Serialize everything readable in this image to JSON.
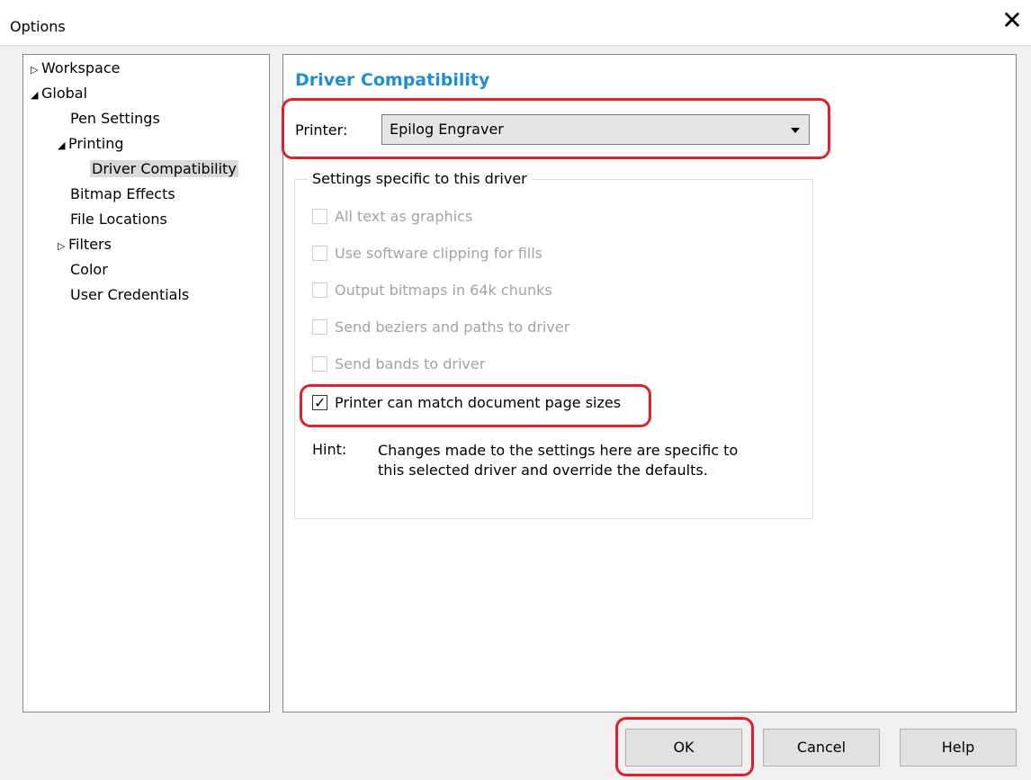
{
  "window": {
    "title": "Options",
    "close_glyph": "✕"
  },
  "tree": {
    "items": [
      {
        "label": "Workspace",
        "arrow": "▷"
      },
      {
        "label": "Global",
        "arrow": "◢"
      },
      {
        "label": "Pen Settings",
        "arrow": ""
      },
      {
        "label": "Printing",
        "arrow": "◢"
      },
      {
        "label": "Driver Compatibility",
        "arrow": "",
        "selected": true
      },
      {
        "label": "Bitmap Effects",
        "arrow": ""
      },
      {
        "label": "File Locations",
        "arrow": ""
      },
      {
        "label": "Filters",
        "arrow": "▷"
      },
      {
        "label": "Color",
        "arrow": ""
      },
      {
        "label": "User Credentials",
        "arrow": ""
      }
    ]
  },
  "panel": {
    "title": "Driver Compatibility",
    "printer_label": "Printer:",
    "printer_value": "Epilog Engraver",
    "group_label": "Settings specific to this driver",
    "options": [
      {
        "label": "All text as graphics",
        "checked": false,
        "enabled": false
      },
      {
        "label": "Use software clipping for fills",
        "checked": false,
        "enabled": false
      },
      {
        "label": "Output bitmaps in 64k chunks",
        "checked": false,
        "enabled": false
      },
      {
        "label": "Send beziers and paths to driver",
        "checked": false,
        "enabled": false
      },
      {
        "label": "Send bands to driver",
        "checked": false,
        "enabled": false
      },
      {
        "label": "Printer can match document page sizes",
        "checked": true,
        "enabled": true
      }
    ],
    "hint_label": "Hint:",
    "hint_text": "Changes made to the settings here are specific to this selected driver and override the defaults."
  },
  "buttons": {
    "ok": "OK",
    "cancel": "Cancel",
    "help": "Help"
  },
  "colors": {
    "title_accent": "#1e8fd6",
    "highlight": "#e0202a"
  }
}
